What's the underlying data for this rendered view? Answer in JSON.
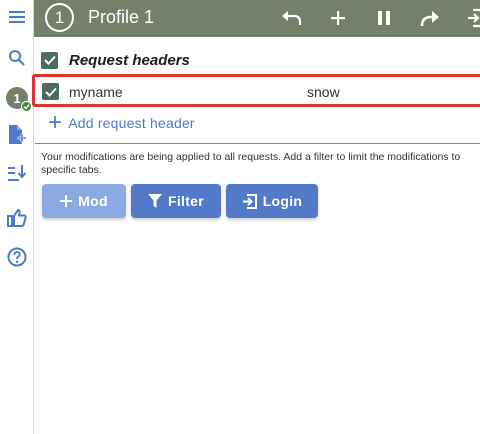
{
  "profile": {
    "number": "1",
    "title": "Profile 1"
  },
  "sidebar": {
    "items": [
      {
        "icon": "menu-icon"
      },
      {
        "icon": "search-icon"
      },
      {
        "icon": "profile-badge",
        "label": "1"
      },
      {
        "icon": "add-file-icon"
      },
      {
        "icon": "sort-icon"
      },
      {
        "icon": "thumbs-up-icon"
      },
      {
        "icon": "help-icon"
      }
    ]
  },
  "toolbar": {
    "icons": [
      "undo-icon",
      "add-icon",
      "pause-icon",
      "redo-icon",
      "export-icon"
    ]
  },
  "request_headers": {
    "title": "Request headers",
    "rows": [
      {
        "name": "myname",
        "value": "snow",
        "enabled": true
      }
    ],
    "add_label": "Add request header"
  },
  "info": "Your modifications are being applied to all requests. Add a filter to limit the modifications to specific tabs.",
  "buttons": {
    "mod_label": "Mod",
    "filter_label": "Filter",
    "login_label": "Login"
  },
  "colors": {
    "topbar": "#75806a",
    "accent": "#5379c9",
    "highlight": "#e0322c",
    "checkbox": "#4a6b5e"
  }
}
